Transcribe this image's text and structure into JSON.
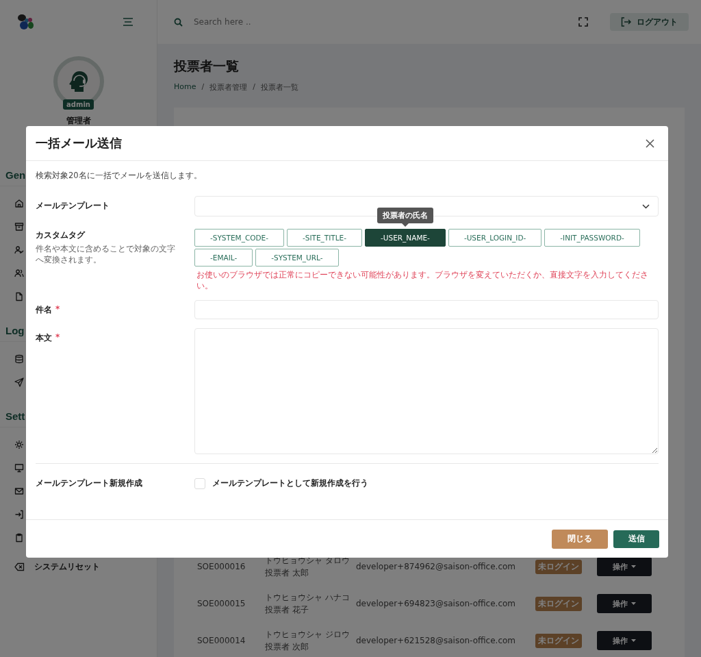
{
  "sidebar": {
    "user": {
      "role_badge": "admin",
      "name": "管理者"
    },
    "sections": [
      {
        "header": "Gen",
        "items": [
          {
            "kind": "home"
          },
          {
            "kind": "archive"
          },
          {
            "kind": "user-check"
          },
          {
            "kind": "users"
          },
          {
            "kind": "file"
          }
        ]
      },
      {
        "header": "Log",
        "items": [
          {
            "kind": "database"
          },
          {
            "kind": "send"
          }
        ]
      },
      {
        "header": "Sett",
        "items": [
          {
            "kind": "gear"
          },
          {
            "kind": "monitor"
          },
          {
            "kind": "mail"
          },
          {
            "kind": "login"
          },
          {
            "kind": "clipboard"
          }
        ]
      }
    ],
    "reset_label": "システムリセット"
  },
  "header": {
    "search_placeholder": "Search here ..",
    "logout": "ログアウト"
  },
  "page": {
    "title": "投票者一覧",
    "breadcrumb": [
      {
        "kind": "link",
        "label": "Home"
      },
      {
        "kind": "separator",
        "label": "/"
      },
      {
        "kind": "text",
        "label": "投票者管理"
      },
      {
        "kind": "separator",
        "label": "/"
      },
      {
        "kind": "text",
        "label": "投票者一覧"
      }
    ]
  },
  "rows": [
    {
      "id": "SOE000016",
      "kana": "トウヒョウシャ タロウ",
      "name": "投票者 太郎",
      "email": "developer+874962@saison-office.com",
      "status": "未ログイン",
      "action": "操作"
    },
    {
      "id": "SOE000015",
      "kana": "トウヒョウシャ ハナコ",
      "name": "投票者 花子",
      "email": "developer+694823@saison-office.com",
      "status": "未ログイン",
      "action": "操作"
    },
    {
      "id": "SOE000014",
      "kana": "トウヒョウシャ ジロウ",
      "name": "投票者 次郎",
      "email": "developer+621528@saison-office.com",
      "status": "未ログイン",
      "action": "操作"
    }
  ],
  "modal": {
    "title": "一括メール送信",
    "description": "検索対象20名に一括でメールを送信します。",
    "fields": [
      {
        "kind": "select",
        "label": "メールテンプレート"
      },
      {
        "kind": "tags",
        "label": "カスタムタグ",
        "help": "件名や本文に含めることで対象の文字へ変換されます。",
        "tooltip": "投票者の氏名",
        "warning": "お使いのブラウザでは正常にコピーできない可能性があります。ブラウザを変えていただくか、直接文字を入力してください。",
        "tags": [
          {
            "label": "-SYSTEM_CODE-",
            "selected": false
          },
          {
            "label": "-SITE_TITLE-",
            "selected": false
          },
          {
            "label": "-USER_NAME-",
            "selected": true
          },
          {
            "label": "-USER_LOGIN_ID-",
            "selected": false
          },
          {
            "label": "-INIT_PASSWORD-",
            "selected": false
          },
          {
            "label": "-EMAIL-",
            "selected": false
          },
          {
            "label": "-SYSTEM_URL-",
            "selected": false
          }
        ]
      },
      {
        "kind": "text",
        "label": "件名",
        "required_mark": "*"
      },
      {
        "kind": "textarea",
        "label": "本文",
        "required_mark": "*"
      },
      {
        "kind": "checkbox",
        "label": "メールテンプレート新規作成",
        "option": "メールテンプレートとして新規作成を行う",
        "checked": false
      }
    ],
    "buttons": [
      {
        "kind": "secondary",
        "label": "閉じる"
      },
      {
        "kind": "primary",
        "label": "送信"
      }
    ]
  }
}
